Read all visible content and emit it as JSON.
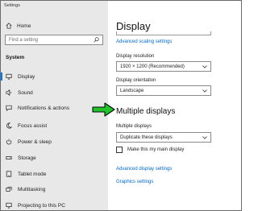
{
  "window": {
    "title": "Settings"
  },
  "sidebar": {
    "home_label": "Home",
    "search_placeholder": "Find a setting",
    "section_label": "System",
    "items": [
      {
        "label": "Display",
        "icon": "monitor-icon",
        "active": true
      },
      {
        "label": "Sound",
        "icon": "speaker-icon"
      },
      {
        "label": "Notifications & actions",
        "icon": "notification-icon"
      },
      {
        "label": "Focus assist",
        "icon": "moon-icon"
      },
      {
        "label": "Power & sleep",
        "icon": "power-icon"
      },
      {
        "label": "Storage",
        "icon": "storage-icon"
      },
      {
        "label": "Tablet mode",
        "icon": "tablet-icon"
      },
      {
        "label": "Multitasking",
        "icon": "multitasking-icon"
      },
      {
        "label": "Projecting to this PC",
        "icon": "projecting-icon"
      }
    ]
  },
  "main": {
    "title": "Display",
    "advanced_scaling_link": "Advanced scaling settings",
    "resolution": {
      "label": "Display resolution",
      "value": "1920 × 1200 (Recommended)"
    },
    "orientation": {
      "label": "Display orientation",
      "value": "Landscape"
    },
    "multiple_displays": {
      "heading": "Multiple displays",
      "label": "Multiple displays",
      "value": "Duplicate these displays",
      "main_display_checkbox": "Make this my main display",
      "main_display_checked": false
    },
    "advanced_display_link": "Advanced display settings",
    "graphics_link": "Graphics settings"
  },
  "colors": {
    "accent": "#0078d7",
    "link": "#0067c0",
    "arrow": "#22c32a",
    "sidebar_bg": "#e8e8e8"
  }
}
